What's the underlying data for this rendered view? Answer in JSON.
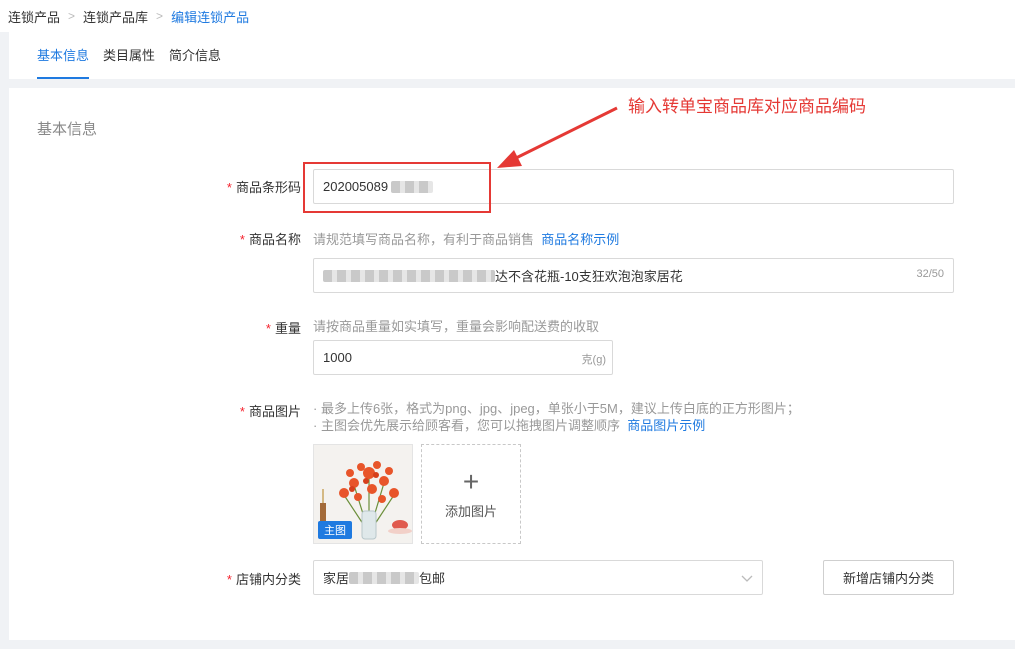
{
  "breadcrumb": [
    "连锁产品",
    "连锁产品库",
    "编辑连锁产品"
  ],
  "tabs": [
    {
      "label": "基本信息",
      "active": true
    },
    {
      "label": "类目属性",
      "active": false
    },
    {
      "label": "简介信息",
      "active": false
    }
  ],
  "section_title": "基本信息",
  "form": {
    "required_mark": "*",
    "barcode": {
      "label": "商品条形码",
      "value": "202005089"
    },
    "name": {
      "label": "商品名称",
      "hint": "请规范填写商品名称，有利于商品销售",
      "link": "商品名称示例",
      "value_suffix": "达不含花瓶-10支狂欢泡泡家居花",
      "counter": "32/50"
    },
    "weight": {
      "label": "重量",
      "hint": "请按商品重量如实填写，重量会影响配送费的收取",
      "value": "1000",
      "unit": "克(g)"
    },
    "images": {
      "label": "商品图片",
      "hint1": "· 最多上传6张，格式为png、jpg、jpeg，单张小于5M，建议上传白底的正方形图片；",
      "hint2": "· 主图会优先展示给顾客看，您可以拖拽图片调整顺序",
      "link": "商品图片示例",
      "main_badge": "主图",
      "add_label": "添加图片"
    },
    "category": {
      "label": "店铺内分类",
      "value_prefix": "家居",
      "value_suffix": "包邮",
      "button": "新增店铺内分类"
    }
  },
  "annotation": "输入转单宝商品库对应商品编码",
  "colors": {
    "accent": "#1f7ae0",
    "required": "#f5222d",
    "annotation": "#e53935"
  }
}
